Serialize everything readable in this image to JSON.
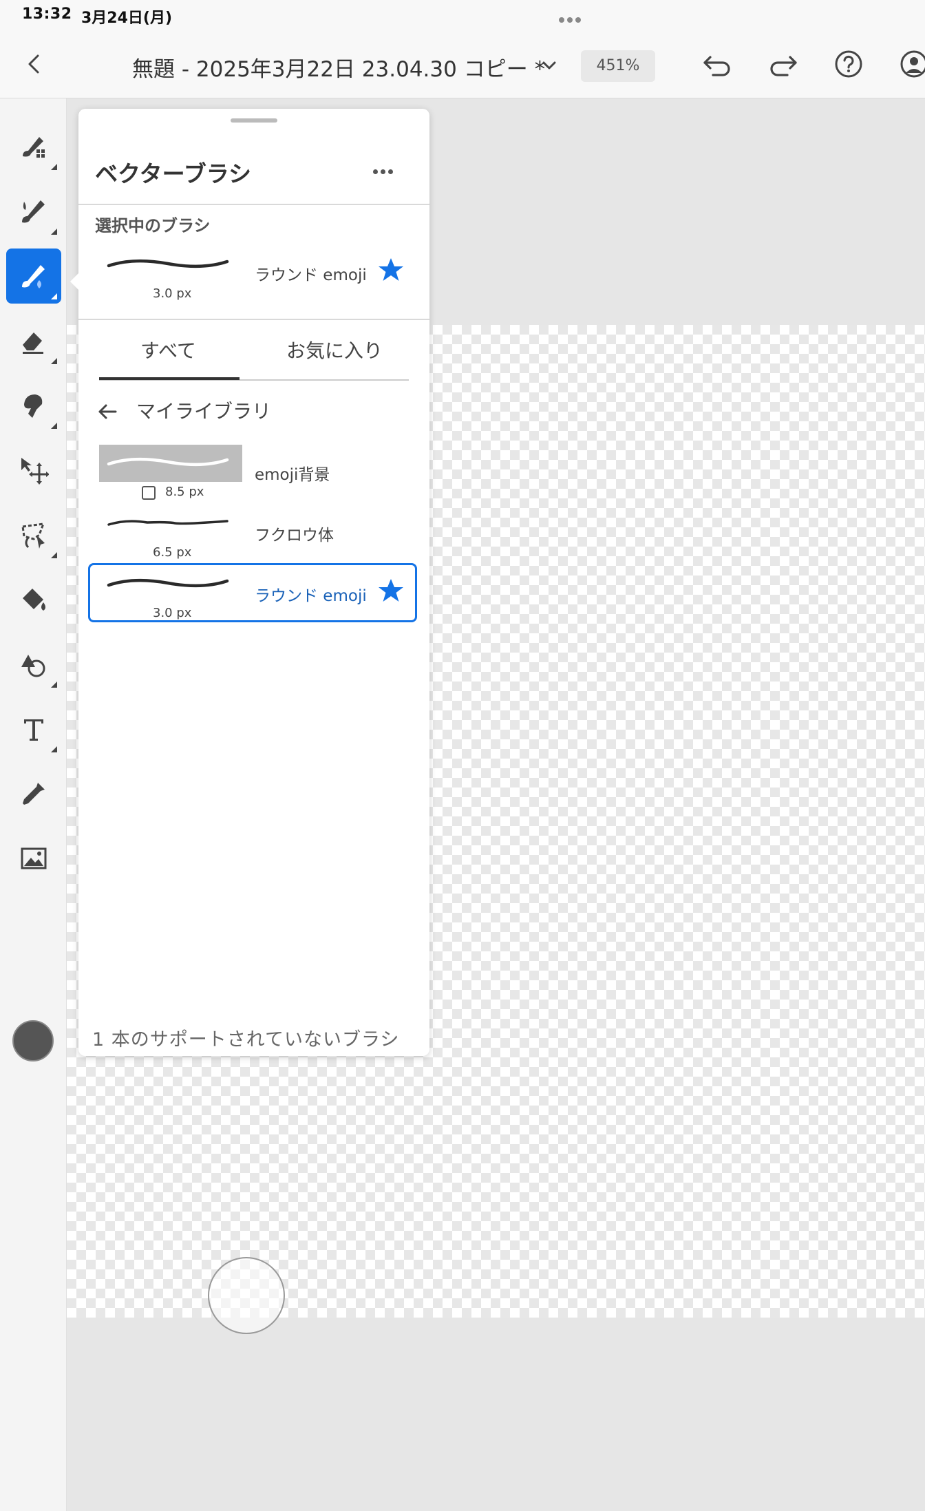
{
  "status_bar": {
    "time": "13:32",
    "date": "3月24日(月)"
  },
  "app_bar": {
    "title": "無題 - 2025年3月22日 23.04.30 コピー *",
    "zoom": "451%"
  },
  "toolbar": {
    "tools": [
      "pixel-brush-icon",
      "paint-brush-icon",
      "vector-brush-icon",
      "eraser-icon",
      "smudge-icon",
      "transform-icon",
      "lasso-icon",
      "fill-icon",
      "shape-icon",
      "text-icon",
      "eyedropper-icon",
      "image-icon"
    ],
    "active_tool": "vector-brush-icon",
    "current_color": "#555555"
  },
  "panel": {
    "title": "ベクターブラシ",
    "selected_section_label": "選択中のブラシ",
    "selected_brush": {
      "name": "ラウンド emoji",
      "size": "3.0 px",
      "favorite": true
    },
    "tabs": [
      "すべて",
      "お気に入り"
    ],
    "active_tab": 0,
    "library_title": "マイライブラリ",
    "brushes": [
      {
        "name": "emoji背景",
        "size": "8.5 px",
        "favorite": false,
        "selected": false
      },
      {
        "name": "フクロウ体",
        "size": "6.5 px",
        "favorite": false,
        "selected": false
      },
      {
        "name": "ラウンド emoji",
        "size": "3.0 px",
        "favorite": true,
        "selected": true
      }
    ],
    "footer": "1 本のサポートされていないブラシ"
  },
  "colors": {
    "accent": "#1473e6",
    "selected_text": "#1a62b8",
    "panel_bg": "#ffffff"
  }
}
